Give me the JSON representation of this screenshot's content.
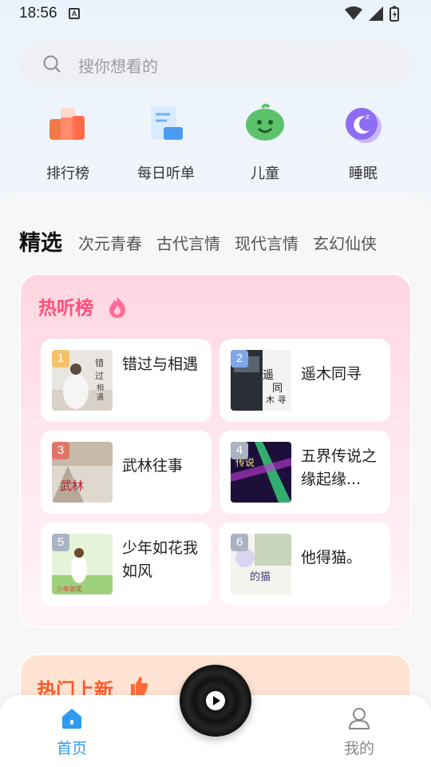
{
  "status": {
    "time": "18:56",
    "a_label": "A"
  },
  "search": {
    "placeholder": "搜你想看的"
  },
  "quick": [
    {
      "label": "排行榜",
      "icon": "ranking-icon"
    },
    {
      "label": "每日听单",
      "icon": "daily-list-icon"
    },
    {
      "label": "儿童",
      "icon": "kids-icon"
    },
    {
      "label": "睡眠",
      "icon": "sleep-icon"
    }
  ],
  "tabs": [
    "精选",
    "次元青春",
    "古代言情",
    "现代言情",
    "玄幻仙侠"
  ],
  "hot": {
    "title": "热听榜",
    "books": [
      {
        "rank": "1",
        "title": "错过与相遇",
        "rank_color": "#f5c26b"
      },
      {
        "rank": "2",
        "title": "遥木同寻",
        "rank_color": "#7fa6e8"
      },
      {
        "rank": "3",
        "title": "武林往事",
        "rank_color": "#e0766a"
      },
      {
        "rank": "4",
        "title": "五界传说之缘起缘...",
        "rank_color": "#a9b3c2"
      },
      {
        "rank": "5",
        "title": "少年如花我如风",
        "rank_color": "#a9b3c2"
      },
      {
        "rank": "6",
        "title": "他得猫。",
        "rank_color": "#a9b3c2"
      }
    ]
  },
  "new": {
    "title": "热门上新"
  },
  "nav": {
    "home": "首页",
    "mine": "我的"
  },
  "colors": {
    "accent": "#2f9bf0",
    "hot": "#ff4f7a",
    "new": "#ff5a2a"
  }
}
